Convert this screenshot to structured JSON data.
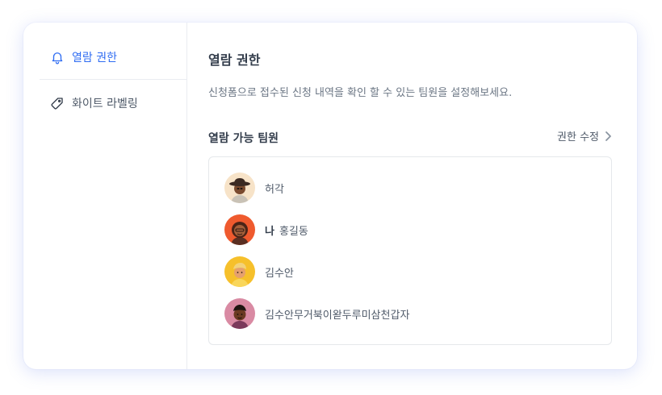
{
  "sidebar": {
    "items": [
      {
        "label": "열람 권한",
        "icon": "bell-icon",
        "active": true
      },
      {
        "label": "화이트 라벨링",
        "icon": "tag-icon",
        "active": false
      }
    ]
  },
  "main": {
    "title": "열람 권한",
    "description": "신청폼으로 접수된 신청 내역을 확인 할 수 있는 팀원을 설정해보세요.",
    "section_title": "열람 가능 팀원",
    "edit_label": "권한 수정",
    "members": [
      {
        "name": "허각",
        "is_me": false
      },
      {
        "name": "홍길동",
        "is_me": true,
        "me_label": "나"
      },
      {
        "name": "김수안",
        "is_me": false
      },
      {
        "name": "김수안무거북이왇두루미삼천갑자",
        "is_me": false
      }
    ]
  },
  "colors": {
    "accent": "#2f6cf2",
    "text_primary": "#333d4b",
    "text_secondary": "#4e5968",
    "border": "#e5e8eb"
  }
}
